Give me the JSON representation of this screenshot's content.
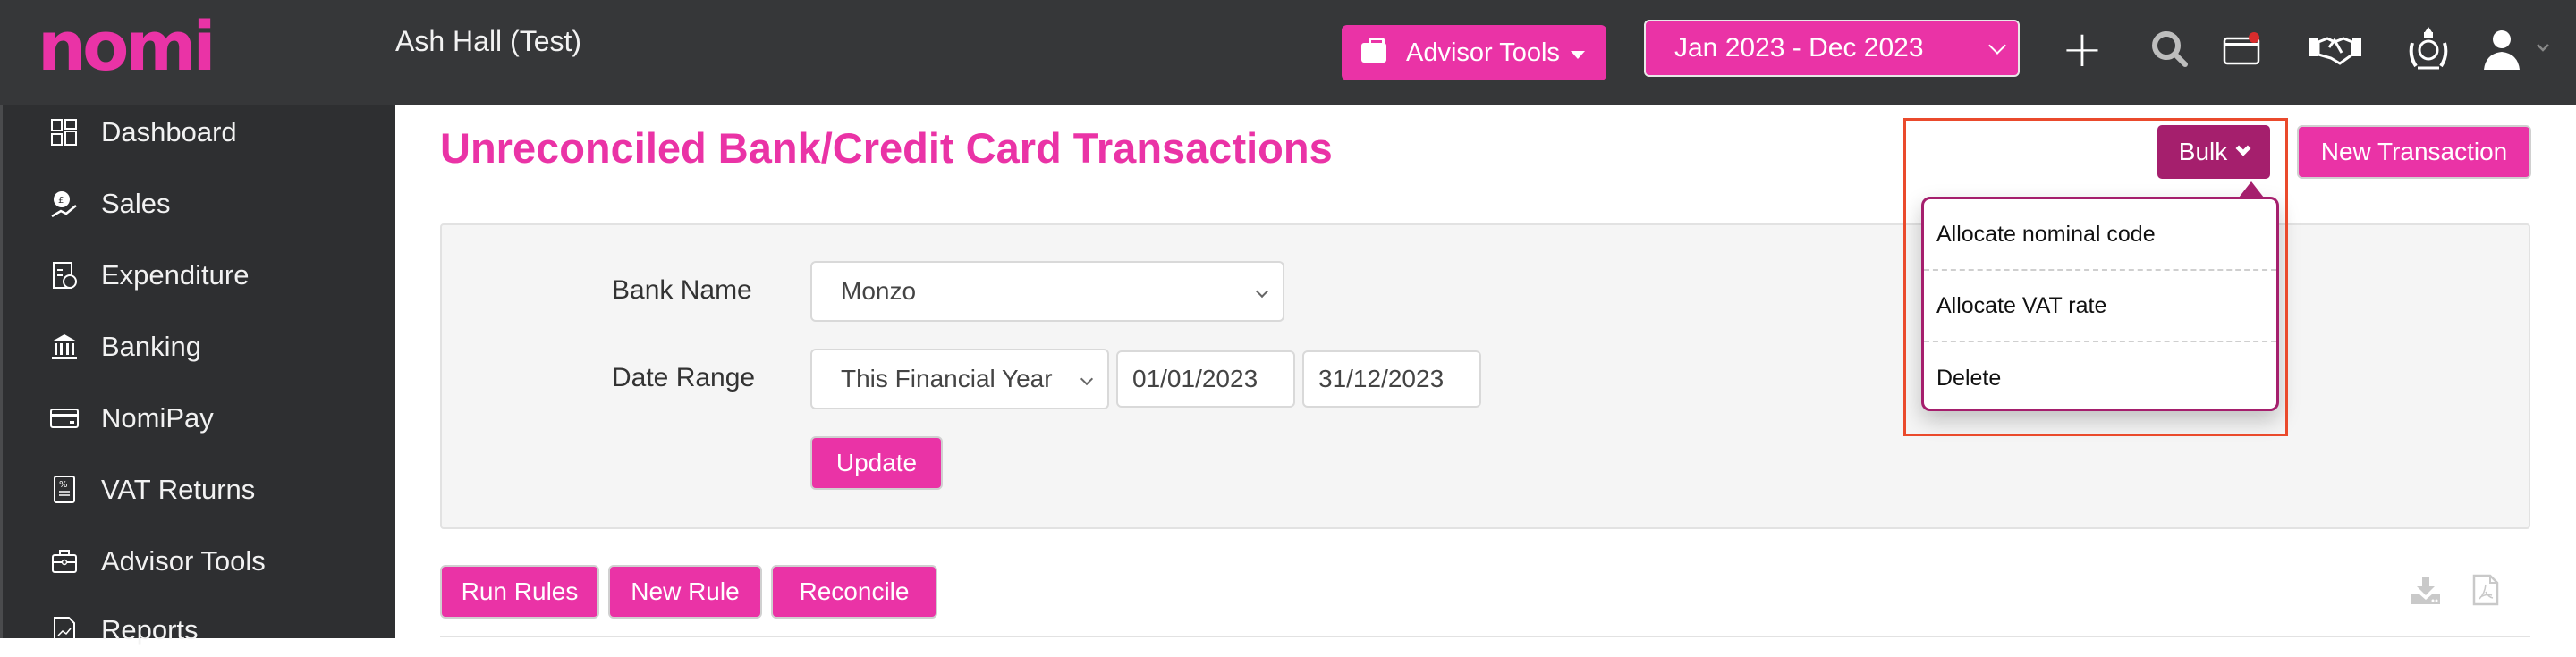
{
  "brand": {
    "logo_text": "nomi",
    "accent_color": "#ea33a6",
    "dark_accent_color": "#a51f6d"
  },
  "header": {
    "company_name": "Ash Hall (Test)",
    "advisor_tools_label": "Advisor Tools",
    "period_selected": "Jan 2023 - Dec 2023",
    "icons": [
      "plus-icon",
      "search-icon",
      "credit-card-notification-icon",
      "handshake-icon",
      "hmrc-crest-icon",
      "user-icon"
    ]
  },
  "sidebar": {
    "items": [
      {
        "label": "Dashboard",
        "icon": "dashboard-icon"
      },
      {
        "label": "Sales",
        "icon": "sales-icon"
      },
      {
        "label": "Expenditure",
        "icon": "expenditure-icon"
      },
      {
        "label": "Banking",
        "icon": "bank-icon"
      },
      {
        "label": "NomiPay",
        "icon": "card-icon"
      },
      {
        "label": "VAT Returns",
        "icon": "vat-document-icon"
      },
      {
        "label": "Advisor Tools",
        "icon": "briefcase-icon"
      },
      {
        "label": "Reports",
        "icon": "report-icon"
      }
    ]
  },
  "main": {
    "title": "Unreconciled Bank/Credit Card Transactions",
    "bulk_button_label": "Bulk",
    "new_transaction_label": "New Transaction",
    "bulk_menu": {
      "items": [
        "Allocate nominal code",
        "Allocate VAT rate",
        "Delete"
      ]
    },
    "filters": {
      "bank_name_label": "Bank Name",
      "bank_name_value": "Monzo",
      "date_range_label": "Date Range",
      "date_range_value": "This Financial Year",
      "date_from": "01/01/2023",
      "date_to": "31/12/2023",
      "update_label": "Update"
    },
    "actions": {
      "run_rules_label": "Run Rules",
      "new_rule_label": "New Rule",
      "reconcile_label": "Reconcile"
    },
    "export_icons": [
      "download-icon",
      "pdf-icon"
    ]
  }
}
